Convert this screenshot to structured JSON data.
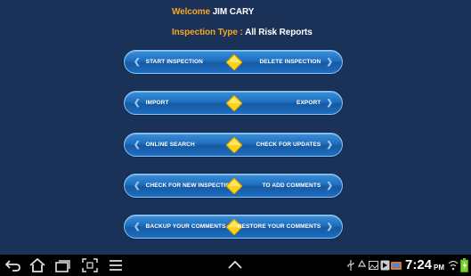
{
  "header": {
    "welcome_label": "Welcome",
    "user_name": "JIM CARY",
    "inspection_type_label": "Inspection Type :",
    "inspection_type_value": "All Risk Reports"
  },
  "menu": [
    {
      "left": "START INSPECTION",
      "right": "DELETE INSPECTION"
    },
    {
      "left": "IMPORT",
      "right": "EXPORT"
    },
    {
      "left": "ONLINE SEARCH",
      "right": "CHECK FOR UPDATES"
    },
    {
      "left": "CHECK FOR NEW INSPECTIONS",
      "right": "TO ADD COMMENTS"
    },
    {
      "left": "BACKUP YOUR COMMENTS",
      "right": "RESTORE YOUR COMMENTS"
    }
  ],
  "status_bar": {
    "time": "7:24",
    "ampm": "PM"
  },
  "icons": {
    "left_arrow": "chevron-left-icon",
    "right_arrow": "chevron-right-icon",
    "separator": "yellow-diamond-icon",
    "nav": [
      "back-icon",
      "home-icon",
      "recent-apps-icon",
      "screenshot-icon",
      "menu-icon",
      "chevron-up-icon"
    ]
  },
  "colors": {
    "background": "#1a3158",
    "accent_orange": "#f5a623",
    "pill_blue": "#1f6fbf",
    "diamond_yellow": "#ffd21a",
    "battery_green": "#7bd12f"
  }
}
